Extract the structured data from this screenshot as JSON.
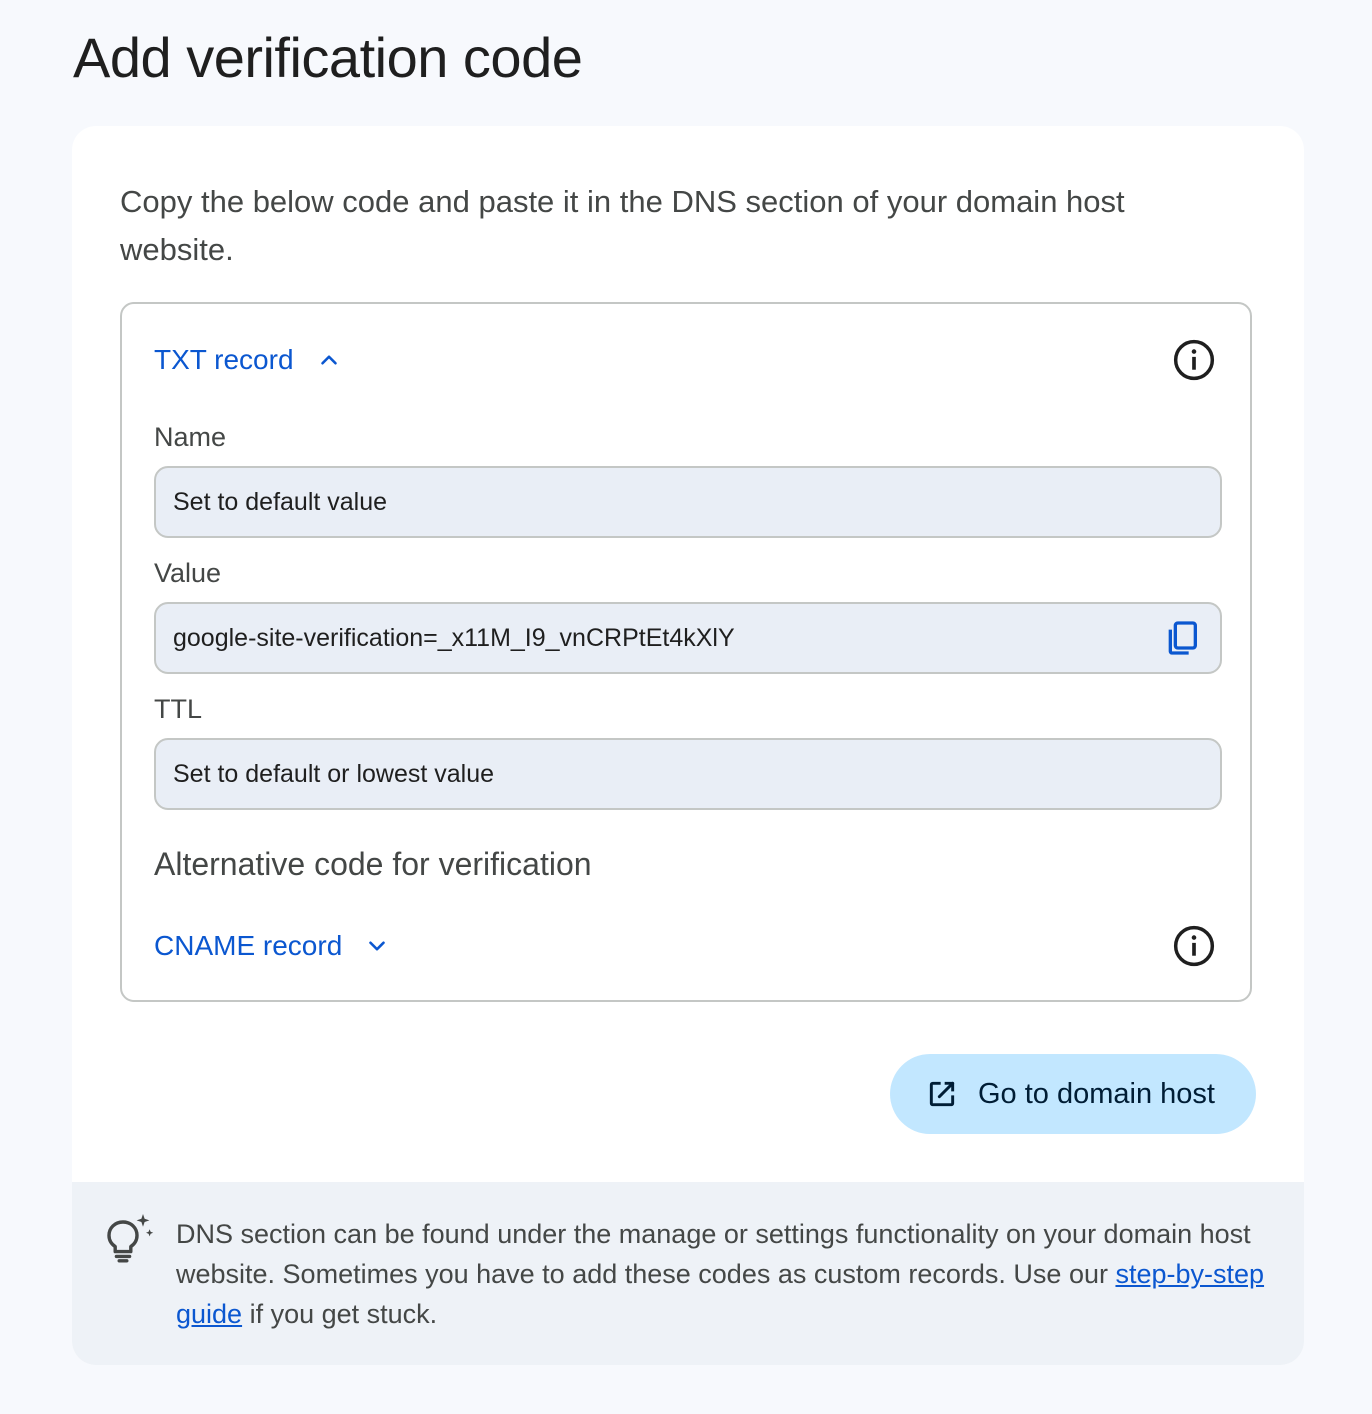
{
  "page": {
    "title": "Add verification code"
  },
  "card": {
    "intro": "Copy the below code and paste it in the DNS section of your domain host website."
  },
  "txt_record": {
    "header": "TXT record",
    "expanded": true,
    "fields": [
      {
        "label": "Name",
        "value": "Set to default value"
      },
      {
        "label": "Value",
        "value": "google-site-verification=_x11M_I9_vnCRPtEt4kXlY",
        "copyable": true
      },
      {
        "label": "TTL",
        "value": "Set to default or lowest value"
      }
    ]
  },
  "alternative": {
    "heading": "Alternative code for verification",
    "cname_header": "CNAME record",
    "expanded": false
  },
  "actions": {
    "go_to_domain_host": "Go to domain host"
  },
  "tip": {
    "text_before": "DNS section can be found under the manage or settings functionality on your domain host website. Sometimes you have to add these codes as custom records. Use our ",
    "link": "step-by-step guide",
    "text_after": " if you get stuck."
  },
  "icons": {
    "info": "info-icon",
    "copy": "copy-icon",
    "external_link": "open-in-new-icon",
    "tip": "lightbulb-sparkle-icon",
    "expand_less": "chevron-up-icon",
    "expand_more": "chevron-down-icon"
  },
  "colors": {
    "link_blue": "#0b57d0",
    "button_bg": "#c2e7ff",
    "field_bg": "#e9eef6",
    "tip_bg": "#eef2f7",
    "page_bg": "#f7f9fd"
  }
}
